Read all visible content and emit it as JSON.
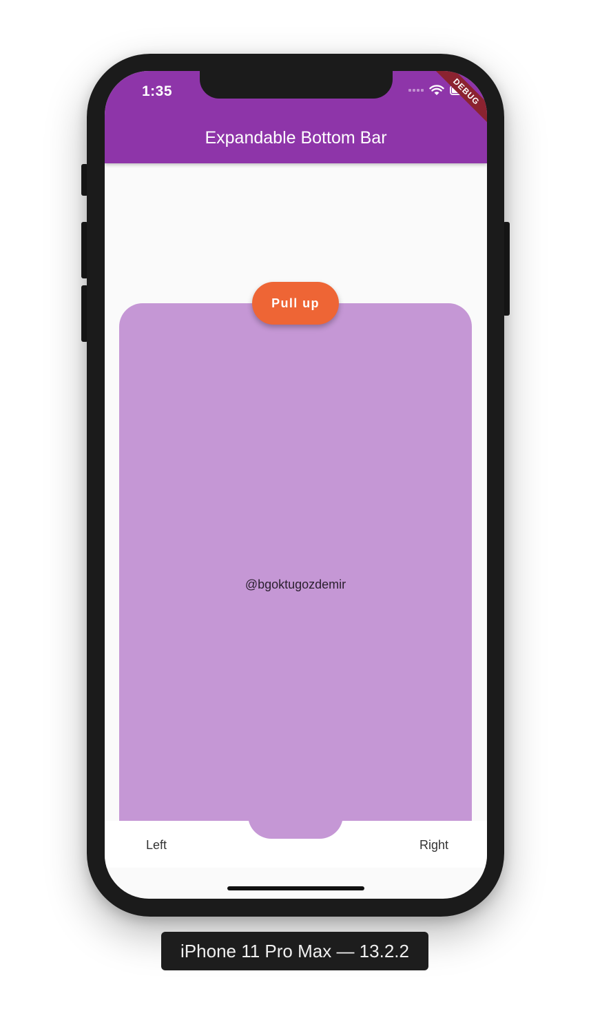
{
  "status_bar": {
    "time": "1:35",
    "icons": [
      "signal-icon",
      "wifi-icon",
      "battery-icon"
    ]
  },
  "debug_banner": "DEBUG",
  "app_bar": {
    "title": "Expandable Bottom Bar",
    "color": "#8e35a9"
  },
  "sheet": {
    "text": "@bgoktugozdemir",
    "color": "#c597d5"
  },
  "pull_button": {
    "label": "Pull up",
    "color": "#ee6535"
  },
  "bottom_bar": {
    "left_label": "Left",
    "right_label": "Right"
  },
  "device_label": "iPhone 11 Pro Max — 13.2.2"
}
